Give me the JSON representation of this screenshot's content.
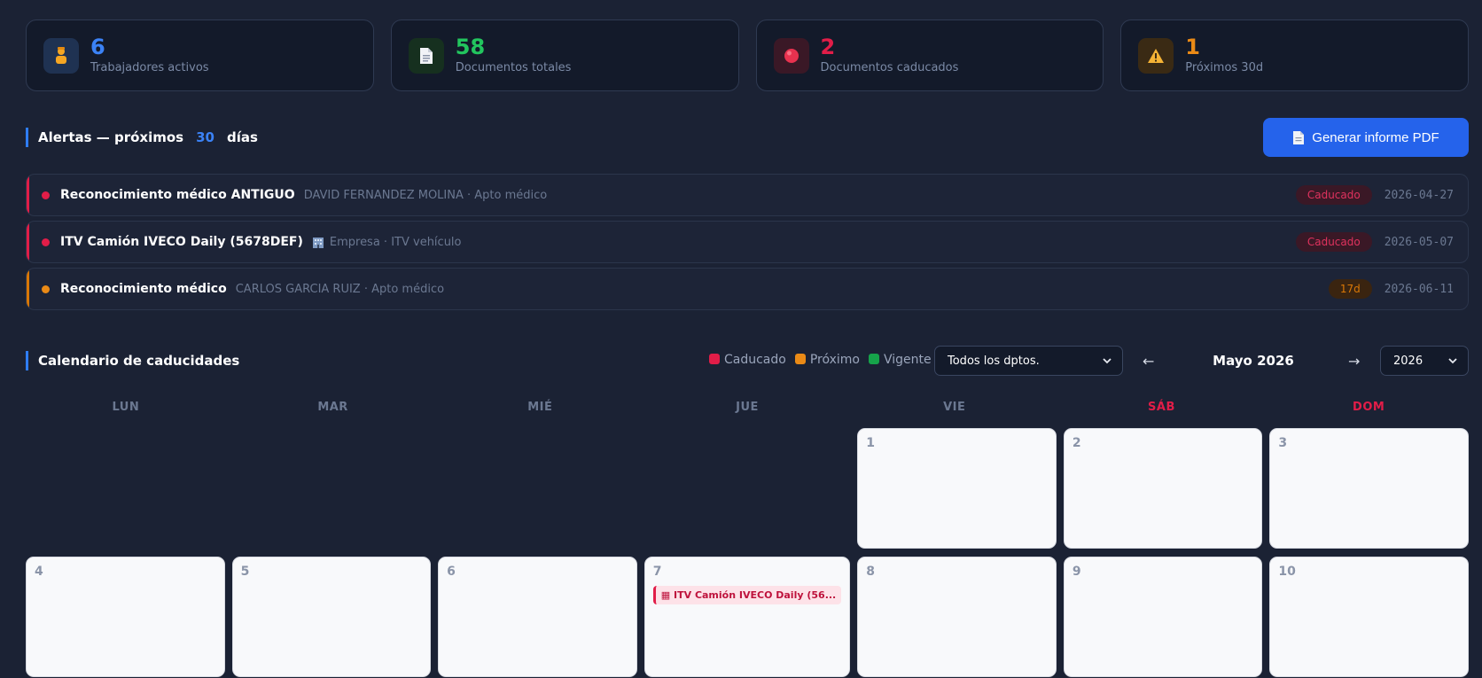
{
  "stats": [
    {
      "value": "6",
      "label": "Trabajadores activos",
      "color": "#3b82f6",
      "icon": "worker-icon"
    },
    {
      "value": "58",
      "label": "Documentos totales",
      "color": "#22c55e",
      "icon": "document-icon"
    },
    {
      "value": "2",
      "label": "Documentos caducados",
      "color": "#e11d48",
      "icon": "red-circle-icon"
    },
    {
      "value": "1",
      "label": "Próximos 30d",
      "color": "#ea8a16",
      "icon": "warning-icon"
    }
  ],
  "alerts_section": {
    "title_pre": "Alertas — próximos",
    "days": "30",
    "title_post": "días",
    "pdf_button": "Generar informe PDF"
  },
  "alerts": [
    {
      "title": "Reconocimiento médico ANTIGUO",
      "meta": "DAVID FERNANDEZ MOLINA · Apto médico",
      "badge": "Caducado",
      "date": "2026-04-27",
      "status": "red"
    },
    {
      "title": "ITV Camión IVECO Daily (5678DEF)",
      "meta": "Empresa · ITV vehículo",
      "badge": "Caducado",
      "date": "2026-05-07",
      "status": "red"
    },
    {
      "title": "Reconocimiento médico",
      "meta": "CARLOS GARCIA RUIZ · Apto médico",
      "badge": "17d",
      "date": "2026-06-11",
      "status": "orange"
    }
  ],
  "calendar": {
    "title": "Calendario de caducidades",
    "legend": {
      "expired": "Caducado",
      "upcoming": "Próximo",
      "valid": "Vigente"
    },
    "dept_select": "Todos los dptos.",
    "month_label": "Mayo 2026",
    "year_select": "2026",
    "prev_arrow": "←",
    "next_arrow": "→",
    "weekdays": [
      "LUN",
      "MAR",
      "MIÉ",
      "JUE",
      "VIE",
      "SÁB",
      "DOM"
    ],
    "days": [
      "1",
      "2",
      "3",
      "4",
      "5",
      "6",
      "7",
      "8",
      "9",
      "10"
    ],
    "event_day7": "ITV Camión IVECO Daily (56..."
  },
  "colors": {
    "expired": "#e11d48",
    "upcoming": "#ea8a16",
    "valid": "#16a34a",
    "accent": "#2563eb"
  }
}
